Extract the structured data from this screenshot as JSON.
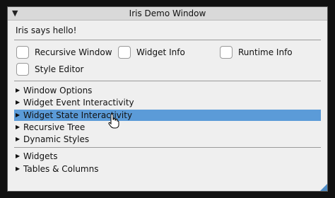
{
  "window": {
    "title": "Iris Demo Window",
    "collapse_arrow": "▼",
    "hello_text": "Iris says hello!"
  },
  "checkboxes": [
    {
      "label": "Recursive Window"
    },
    {
      "label": "Widget Info"
    },
    {
      "label": "Runtime Info"
    },
    {
      "label": "Style Editor"
    }
  ],
  "tree": {
    "arrow": "▶",
    "group1": [
      {
        "label": "Window Options"
      },
      {
        "label": "Widget Event Interactivity"
      },
      {
        "label": "Widget State Interactivity",
        "selected": true
      },
      {
        "label": "Recursive Tree"
      },
      {
        "label": "Dynamic Styles"
      }
    ],
    "group2": [
      {
        "label": "Widgets"
      },
      {
        "label": "Tables & Columns"
      }
    ]
  },
  "colors": {
    "selected_row": "#5b9bd8",
    "resize_grip": "#4f8dc7"
  },
  "icons": {
    "cursor": "hand-pointer-icon",
    "collapse": "triangle-down-icon",
    "expand": "triangle-right-icon"
  }
}
